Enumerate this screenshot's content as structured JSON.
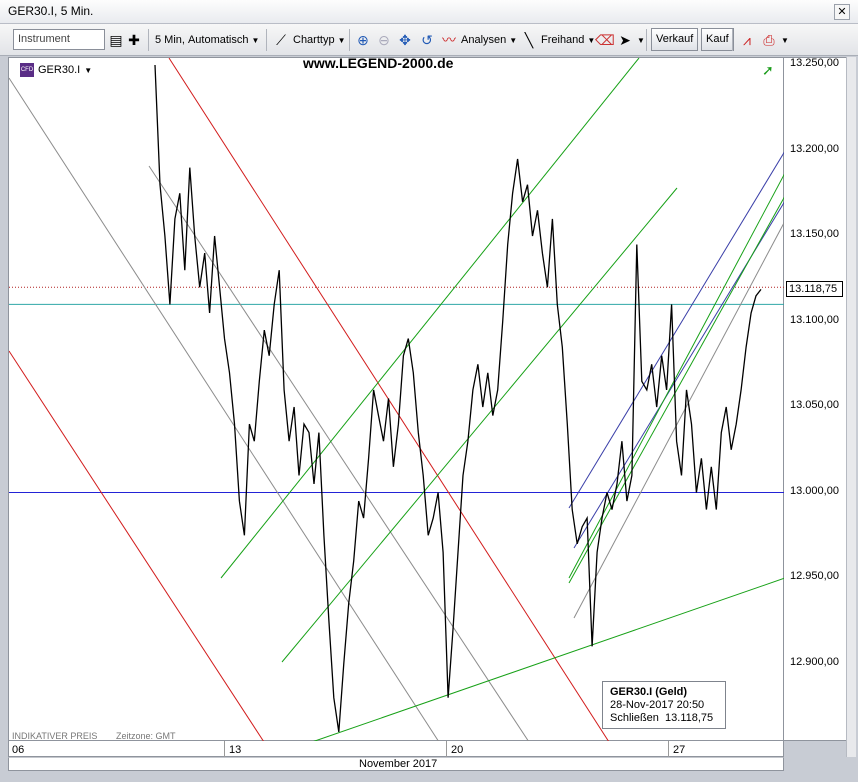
{
  "window": {
    "title": "GER30.I, 5 Min."
  },
  "toolbar": {
    "instrument_placeholder": "Instrument",
    "interval": "5 Min,",
    "mode": "Automatisch",
    "charttype": "Charttyp",
    "analysen": "Analysen",
    "freihand": "Freihand",
    "verkauf": "Verkauf",
    "kauf": "Kauf"
  },
  "chart": {
    "instrument": "GER30.I",
    "instrument_badge": "CFD",
    "watermark": "www.LEGEND-2000.de",
    "indikativ": "INDIKATIVER PREIS",
    "zeitzone": "Zeitzone: GMT",
    "last_price": "13.118,75",
    "colors": {
      "price": "#000000",
      "red_channel": "#d21c1c",
      "gray_channel": "#8c8c8c",
      "green_channel": "#17a117",
      "blue_channel": "#3a3fa8",
      "blue_hline": "#2323d6",
      "teal_hline": "#2fa7a7"
    }
  },
  "legend": {
    "title": "GER30.I (Geld)",
    "datetime": "28-Nov-2017 20:50",
    "label": "Schließen",
    "value": "13.118,75"
  },
  "chart_data": {
    "type": "line",
    "y_ticks": [
      "13.250,00",
      "13.200,00",
      "13.150,00",
      "13.100,00",
      "13.050,00",
      "13.000,00",
      "12.950,00",
      "12.900,00"
    ],
    "x_ticks": [
      "06",
      "13",
      "20",
      "27"
    ],
    "x_month_label": "November 2017",
    "ylim": [
      12850,
      13255
    ],
    "hlines": [
      13000,
      13110,
      13120
    ],
    "series": [
      {
        "values": [
          13250,
          13180,
          13150,
          13110,
          13160,
          13175,
          13130,
          13190,
          13150,
          13120,
          13140,
          13105,
          13150,
          13120,
          13090,
          13070,
          13040,
          12995,
          12975,
          13040,
          13030,
          13065,
          13095,
          13080,
          13110,
          13130,
          13060,
          13030,
          13050,
          13010,
          13040,
          13035,
          13005,
          13035,
          12975,
          12925,
          12880,
          12860,
          12900,
          12935,
          12960,
          12995,
          12985,
          13020,
          13060,
          13045,
          13030,
          13055,
          13015,
          13040,
          13080,
          13090,
          13070,
          13035,
          13010,
          12975,
          12985,
          13000,
          12965,
          12880,
          12920,
          12965,
          13010,
          13030,
          13060,
          13075,
          13050,
          13070,
          13045,
          13060,
          13100,
          13145,
          13175,
          13195,
          13170,
          13180,
          13150,
          13165,
          13140,
          13120,
          13160,
          13110,
          13085,
          13040,
          12990,
          12970,
          12980,
          12985,
          12910,
          12965,
          12985,
          13000,
          12990,
          13005,
          13030,
          12995,
          13010,
          13145,
          13065,
          13060,
          13075,
          13050,
          13080,
          13060,
          13110,
          13030,
          13010,
          13060,
          13040,
          13000,
          13020,
          12990,
          13015,
          12990,
          13035,
          13050,
          13025,
          13040,
          13060,
          13085,
          13105,
          13115,
          13118.75
        ]
      }
    ]
  }
}
